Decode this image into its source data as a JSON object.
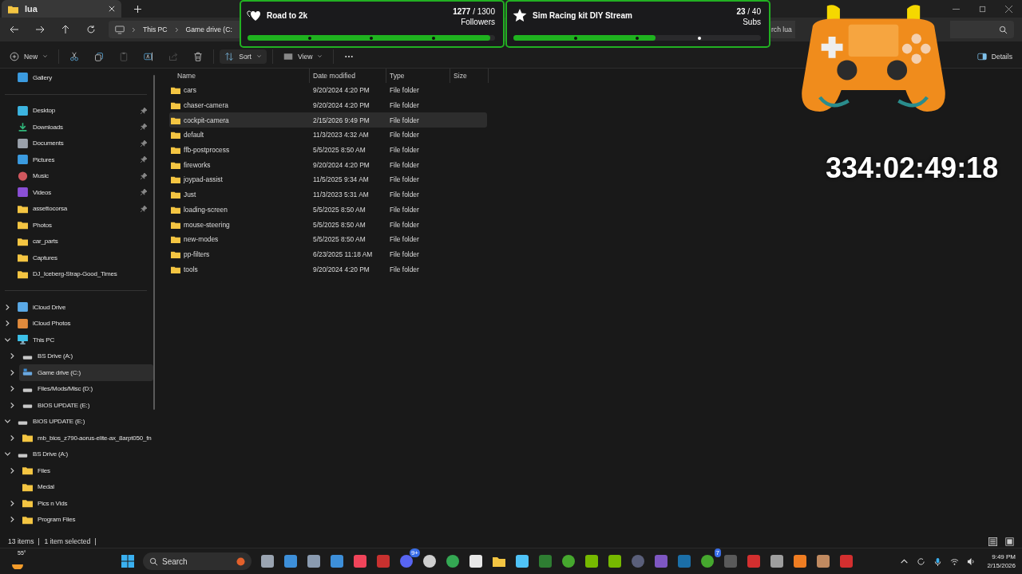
{
  "window": {
    "tab": {
      "title": "lua",
      "selected": true
    }
  },
  "address": {
    "crumbs": [
      "This PC",
      "Game drive (C:"
    ],
    "search_placeholder": "rch lua"
  },
  "toolbar": [
    {
      "kind": "new",
      "label": "New",
      "disabled": false
    },
    {
      "kind": "cut",
      "disabled": false
    },
    {
      "kind": "copy",
      "disabled": false
    },
    {
      "kind": "paste",
      "disabled": true
    },
    {
      "kind": "rename",
      "disabled": false
    },
    {
      "kind": "share",
      "disabled": true
    },
    {
      "kind": "delete",
      "disabled": false
    },
    {
      "kind": "sort",
      "label": "Sort",
      "disabled": false
    },
    {
      "kind": "view",
      "label": "View",
      "disabled": false
    },
    {
      "kind": "more",
      "disabled": false
    }
  ],
  "details_button": "Details",
  "sidebar": {
    "sections": [
      {
        "items": [
          {
            "kind": "gallery",
            "label": "Gallery",
            "selected": false
          }
        ]
      },
      {
        "items": [
          {
            "kind": "desktop",
            "label": "Desktop",
            "pinned": true,
            "selected": false
          },
          {
            "kind": "downloads",
            "label": "Downloads",
            "pinned": true,
            "selected": false
          },
          {
            "kind": "documents",
            "label": "Documents",
            "pinned": true,
            "selected": false
          },
          {
            "kind": "pictures",
            "label": "Pictures",
            "pinned": true,
            "selected": false
          },
          {
            "kind": "music",
            "label": "Music",
            "pinned": true,
            "selected": false
          },
          {
            "kind": "videos",
            "label": "Videos",
            "pinned": true,
            "selected": false
          },
          {
            "kind": "folder",
            "label": "assettocorsa",
            "pinned": true,
            "selected": false
          },
          {
            "kind": "folder",
            "label": "Photos",
            "pinned": false,
            "selected": false
          },
          {
            "kind": "folder",
            "label": "car_parts",
            "pinned": false,
            "selected": false
          },
          {
            "kind": "folder",
            "label": "Captures",
            "pinned": false,
            "selected": false
          },
          {
            "kind": "folder",
            "label": "DJ_Iceberg-Strap-Good_Times",
            "pinned": false,
            "selected": false
          }
        ]
      },
      {
        "items": [
          {
            "kind": "cloud",
            "label": "iCloud Drive",
            "expanded": false,
            "selected": false
          },
          {
            "kind": "photos",
            "label": "iCloud Photos",
            "expanded": false,
            "selected": false
          },
          {
            "kind": "pc",
            "label": "This PC",
            "expanded": true,
            "selected": false,
            "children": [
              {
                "kind": "drive",
                "label": "BS Drive (A:)",
                "expanded": false,
                "selected": false
              },
              {
                "kind": "system-drive",
                "label": "Game drive (C:)",
                "expanded": false,
                "selected": true
              },
              {
                "kind": "drive",
                "label": "Files/Mods/Misc (D:)",
                "expanded": false,
                "selected": false
              },
              {
                "kind": "drive",
                "label": "BIOS UPDATE (E:)",
                "expanded": false,
                "selected": false
              }
            ]
          },
          {
            "kind": "drive",
            "label": "BIOS UPDATE (E:)",
            "expanded": true,
            "selected": false,
            "children": [
              {
                "kind": "folder",
                "label": "mb_bios_z790-aorus-elite-ax_8arpt050_fn",
                "expanded": false,
                "selected": false
              }
            ]
          },
          {
            "kind": "drive",
            "label": "BS Drive (A:)",
            "expanded": true,
            "selected": false,
            "children": [
              {
                "kind": "folder",
                "label": "Files",
                "expanded": false,
                "selected": false
              },
              {
                "kind": "folder",
                "label": "Medal",
                "selected": false
              },
              {
                "kind": "folder",
                "label": "Pics n Vids",
                "expanded": false,
                "selected": false
              },
              {
                "kind": "folder",
                "label": "Program Files",
                "expanded": false,
                "selected": false
              }
            ]
          }
        ]
      }
    ]
  },
  "table": {
    "columns": [
      "Name",
      "Date modified",
      "Type",
      "Size"
    ],
    "rows": [
      {
        "name": "cars",
        "date": "9/20/2024 4:20 PM",
        "type": "File folder",
        "selected": false
      },
      {
        "name": "chaser-camera",
        "date": "9/20/2024 4:20 PM",
        "type": "File folder",
        "selected": false
      },
      {
        "name": "cockpit-camera",
        "date": "2/15/2026 9:49 PM",
        "type": "File folder",
        "selected": true
      },
      {
        "name": "default",
        "date": "11/3/2023 4:32 AM",
        "type": "File folder",
        "selected": false
      },
      {
        "name": "ffb-postprocess",
        "date": "5/5/2025 8:50 AM",
        "type": "File folder",
        "selected": false
      },
      {
        "name": "fireworks",
        "date": "9/20/2024 4:20 PM",
        "type": "File folder",
        "selected": false
      },
      {
        "name": "joypad-assist",
        "date": "11/5/2025 9:34 AM",
        "type": "File folder",
        "selected": false
      },
      {
        "name": "Just",
        "date": "11/3/2023 5:31 AM",
        "type": "File folder",
        "selected": false
      },
      {
        "name": "loading-screen",
        "date": "5/5/2025 8:50 AM",
        "type": "File folder",
        "selected": false
      },
      {
        "name": "mouse-steering",
        "date": "5/5/2025 8:50 AM",
        "type": "File folder",
        "selected": false
      },
      {
        "name": "new-modes",
        "date": "5/5/2025 8:50 AM",
        "type": "File folder",
        "selected": false
      },
      {
        "name": "pp-filters",
        "date": "6/23/2025 11:18 AM",
        "type": "File folder",
        "selected": false
      },
      {
        "name": "tools",
        "date": "9/20/2024 4:20 PM",
        "type": "File folder",
        "selected": false
      }
    ]
  },
  "status_bar": {
    "count": "13 items",
    "selection": "1 item selected"
  },
  "taskbar": {
    "weather": "55°",
    "search_placeholder": "Search",
    "apps": [
      {
        "kind": "window"
      },
      {
        "kind": "picture"
      },
      {
        "kind": "gear"
      },
      {
        "kind": "picture"
      },
      {
        "kind": "music"
      },
      {
        "kind": "voice"
      },
      {
        "kind": "chat",
        "badge": "9+"
      },
      {
        "kind": "disc"
      },
      {
        "kind": "browser"
      },
      {
        "kind": "knot"
      },
      {
        "kind": "folder"
      },
      {
        "kind": "notes"
      },
      {
        "kind": "terminal"
      },
      {
        "kind": "xbox"
      },
      {
        "kind": "chip"
      },
      {
        "kind": "chip"
      },
      {
        "kind": "circle"
      },
      {
        "kind": "pad"
      },
      {
        "kind": "steam"
      },
      {
        "kind": "xbox",
        "badge": "7"
      },
      {
        "kind": "game"
      },
      {
        "kind": "red"
      },
      {
        "kind": "cursor"
      },
      {
        "kind": "orange"
      },
      {
        "kind": "bars"
      },
      {
        "kind": "red"
      }
    ],
    "time": "9:49 PM",
    "date": "2/15/2026"
  },
  "overlays": {
    "goals": [
      {
        "kind": "heart",
        "title": "Road to 2k",
        "count": "1277",
        "target": "/ 1300",
        "unit": "Followers",
        "level": 0.98
      },
      {
        "kind": "star",
        "title": "Sim Racing kit DIY Stream",
        "count": "23",
        "target": "/ 40",
        "unit": "Subs",
        "level": 0.575
      }
    ],
    "timer": "334:02:49:18"
  }
}
